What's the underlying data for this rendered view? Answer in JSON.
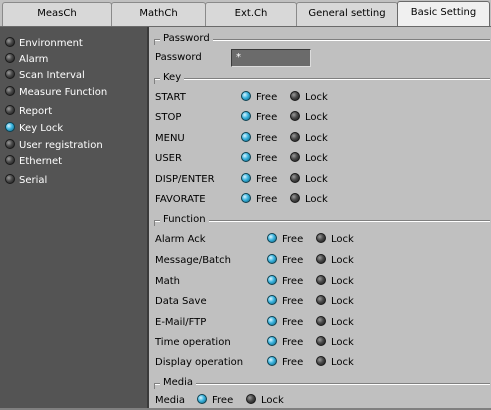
{
  "tabs": [
    {
      "label": "MeasCh",
      "active": false
    },
    {
      "label": "MathCh",
      "active": false
    },
    {
      "label": "Ext.Ch",
      "active": false
    },
    {
      "label": "General setting",
      "active": false
    },
    {
      "label": "Basic Setting",
      "active": true
    }
  ],
  "sidebar": {
    "items": [
      {
        "label": "Environment",
        "selected": false
      },
      {
        "label": "Alarm",
        "selected": false
      },
      {
        "label": "Scan Interval",
        "selected": false
      },
      {
        "label": "Measure Function",
        "selected": false
      },
      {
        "label": "Report",
        "selected": false
      },
      {
        "label": "Key Lock",
        "selected": true
      },
      {
        "label": "User registration",
        "selected": false
      },
      {
        "label": "Ethernet",
        "selected": false
      },
      {
        "label": "Serial",
        "selected": false
      }
    ]
  },
  "password": {
    "title": "Password",
    "label": "Password",
    "value": "*"
  },
  "key": {
    "title": "Key",
    "rows": [
      {
        "label": "START",
        "free": "Free",
        "lock": "Lock",
        "state": "free"
      },
      {
        "label": "STOP",
        "free": "Free",
        "lock": "Lock",
        "state": "free"
      },
      {
        "label": "MENU",
        "free": "Free",
        "lock": "Lock",
        "state": "free"
      },
      {
        "label": "USER",
        "free": "Free",
        "lock": "Lock",
        "state": "free"
      },
      {
        "label": "DISP/ENTER",
        "free": "Free",
        "lock": "Lock",
        "state": "free"
      },
      {
        "label": "FAVORATE",
        "free": "Free",
        "lock": "Lock",
        "state": "free"
      }
    ]
  },
  "function": {
    "title": "Function",
    "rows": [
      {
        "label": "Alarm Ack",
        "free": "Free",
        "lock": "Lock",
        "state": "free"
      },
      {
        "label": "Message/Batch",
        "free": "Free",
        "lock": "Lock",
        "state": "free"
      },
      {
        "label": "Math",
        "free": "Free",
        "lock": "Lock",
        "state": "free"
      },
      {
        "label": "Data Save",
        "free": "Free",
        "lock": "Lock",
        "state": "free"
      },
      {
        "label": "E-Mail/FTP",
        "free": "Free",
        "lock": "Lock",
        "state": "free"
      },
      {
        "label": "Time operation",
        "free": "Free",
        "lock": "Lock",
        "state": "free"
      },
      {
        "label": "Display operation",
        "free": "Free",
        "lock": "Lock",
        "state": "free"
      }
    ]
  },
  "media": {
    "title": "Media",
    "label": "Media",
    "free": "Free",
    "lock": "Lock",
    "state": "free"
  },
  "colors": {
    "sidebar_bg": "#545454",
    "panel_bg": "#c0c0c0",
    "radio_on": "#39b3de",
    "radio_off": "#4a4a4a"
  },
  "icons": {
    "radio_on": "radio-selected-icon",
    "radio_off": "radio-unselected-icon"
  }
}
